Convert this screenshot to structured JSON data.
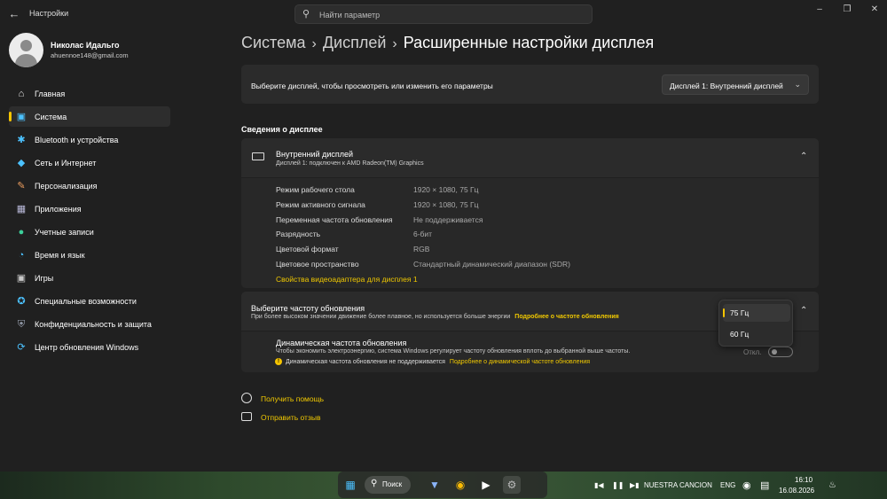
{
  "window": {
    "app_title": "Настройки",
    "search_placeholder": "Найти параметр"
  },
  "profile": {
    "name": "Николас Идальго",
    "email": "ahuennoe148@gmail.com"
  },
  "nav": [
    {
      "label": "Главная",
      "icon": "home-icon"
    },
    {
      "label": "Система",
      "icon": "system-icon"
    },
    {
      "label": "Bluetooth и устройства",
      "icon": "bluetooth-icon"
    },
    {
      "label": "Сеть и Интернет",
      "icon": "wifi-icon"
    },
    {
      "label": "Персонализация",
      "icon": "brush-icon"
    },
    {
      "label": "Приложения",
      "icon": "apps-icon"
    },
    {
      "label": "Учетные записи",
      "icon": "account-icon"
    },
    {
      "label": "Время и язык",
      "icon": "globe-icon"
    },
    {
      "label": "Игры",
      "icon": "gamepad-icon"
    },
    {
      "label": "Специальные возможности",
      "icon": "accessibility-icon"
    },
    {
      "label": "Конфиденциальность и защита",
      "icon": "shield-icon"
    },
    {
      "label": "Центр обновления Windows",
      "icon": "update-icon"
    }
  ],
  "breadcrumb": {
    "level1": "Система",
    "level2": "Дисплей",
    "current": "Расширенные настройки дисплея"
  },
  "select_display": {
    "label": "Выберите дисплей, чтобы просмотреть или изменить его параметры",
    "value": "Дисплей 1: Внутренний дисплей"
  },
  "section_title": "Сведения о дисплее",
  "display_card": {
    "title": "Внутренний дисплей",
    "subtitle": "Дисплей 1: подключен к AMD Radeon(TM) Graphics",
    "rows": [
      {
        "key": "Режим рабочего стола",
        "value": "1920 × 1080, 75 Гц"
      },
      {
        "key": "Режим активного сигнала",
        "value": "1920 × 1080, 75 Гц"
      },
      {
        "key": "Переменная частота обновления",
        "value": "Не поддерживается"
      },
      {
        "key": "Разрядность",
        "value": "6-бит"
      },
      {
        "key": "Цветовой формат",
        "value": "RGB"
      },
      {
        "key": "Цветовое пространство",
        "value": "Стандартный динамический диапазон (SDR)"
      }
    ],
    "link": "Свойства видеоадаптера для дисплея 1"
  },
  "refresh": {
    "title": "Выберите частоту обновления",
    "desc": "При более высоком значении движение более плавное, но используется больше энергии",
    "link": "Подробнее о частоте обновления",
    "options": [
      "75 Гц",
      "60 Гц"
    ],
    "dynamic_title": "Динамическая частота обновления",
    "dynamic_desc": "Чтобы экономить электроэнергию, система Windows регулирует частоту обновления вплоть до выбранной выше частоты.",
    "warning": "Динамическая частота обновления не поддерживается",
    "warning_link": "Подробнее о динамической частоте обновления",
    "toggle_label": "Откл."
  },
  "footer_links": {
    "help": "Получить помощь",
    "feedback": "Отправить отзыв"
  },
  "taskbar": {
    "search_label": "Поиск",
    "media_title": "NUESTRA CANCION",
    "lang": "ENG",
    "time": "16:10",
    "date": "16.08.2026"
  },
  "colors": {
    "accent": "#f5c400",
    "background": "#202020",
    "card": "#2b2b2b"
  }
}
